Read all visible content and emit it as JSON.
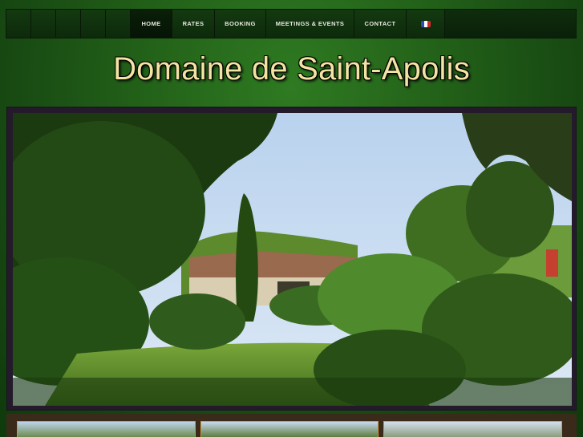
{
  "site": {
    "title": "Domaine de Saint-Apolis"
  },
  "nav": {
    "items": [
      {
        "label": "HOME",
        "active": true
      },
      {
        "label": "RATES",
        "active": false
      },
      {
        "label": "BOOKING",
        "active": false
      },
      {
        "label": "MEETINGS & EVENTS",
        "active": false
      },
      {
        "label": "CONTACT",
        "active": false
      }
    ],
    "language_icon": "french-flag-icon"
  },
  "colors": {
    "background": "#236219",
    "title_text": "#f3e3a4",
    "nav_bar": "#0f2d0c",
    "hero_frame": "#241a2b",
    "thumb_border": "#c99a3b"
  }
}
